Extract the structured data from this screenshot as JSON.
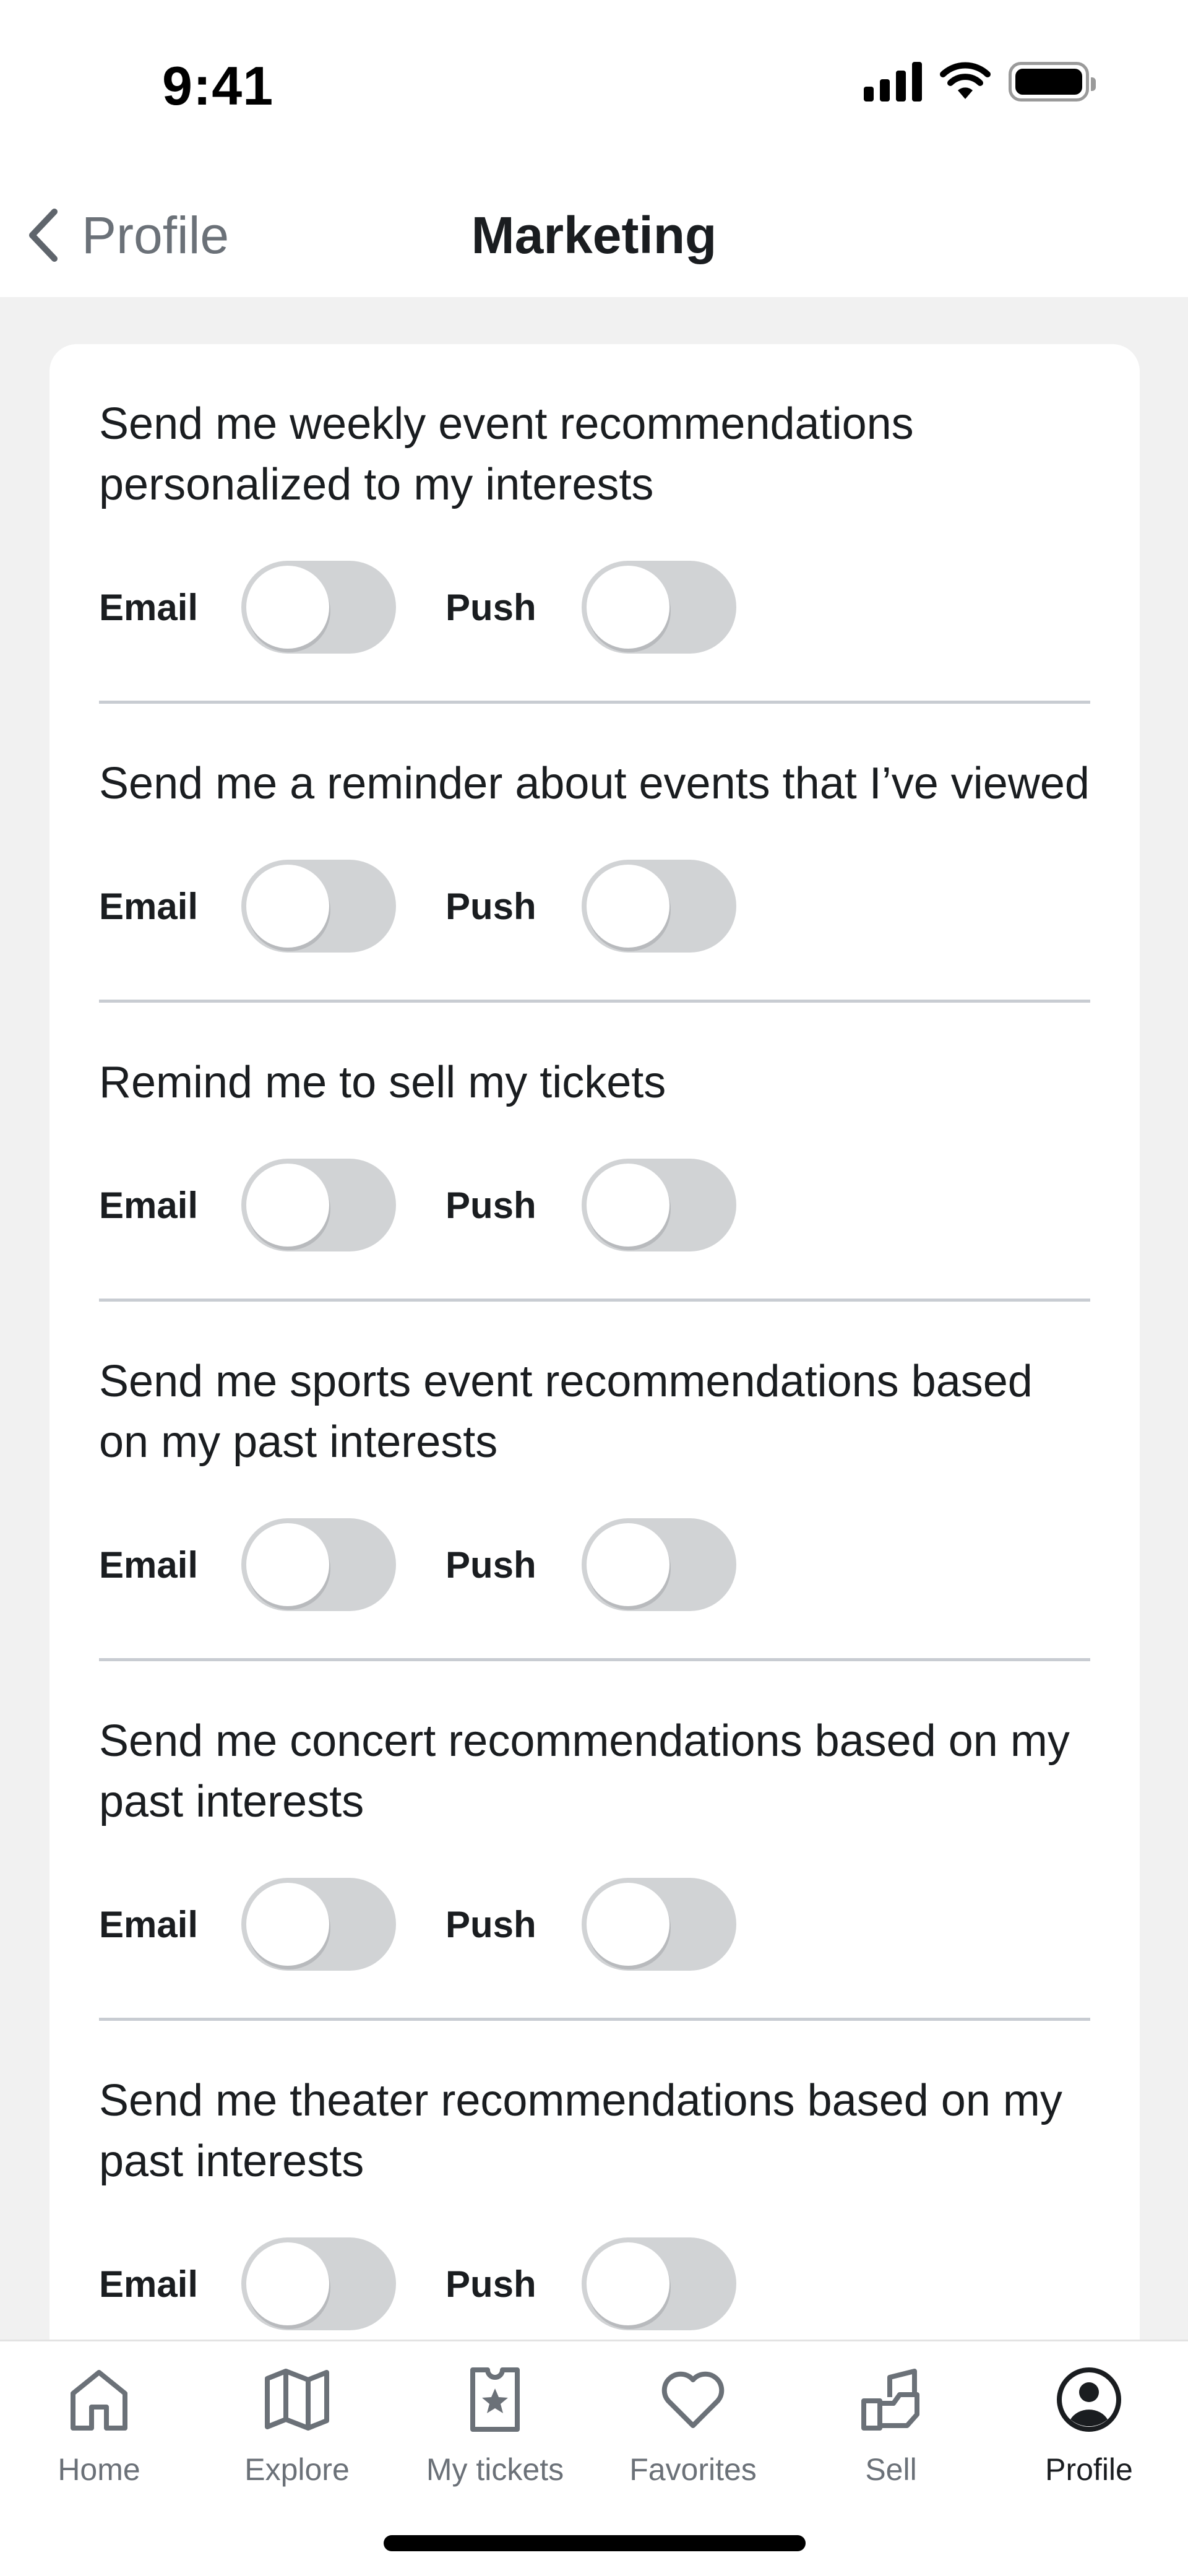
{
  "status_bar": {
    "time": "9:41"
  },
  "nav": {
    "back_label": "Profile",
    "title": "Marketing"
  },
  "preferences": [
    {
      "title": "Send me weekly event recommendations personalized to my interests",
      "email_label": "Email",
      "push_label": "Push",
      "email_on": false,
      "push_on": false
    },
    {
      "title": "Send me a reminder about events that I’ve viewed",
      "email_label": "Email",
      "push_label": "Push",
      "email_on": false,
      "push_on": false
    },
    {
      "title": "Remind me to sell my tickets",
      "email_label": "Email",
      "push_label": "Push",
      "email_on": false,
      "push_on": false
    },
    {
      "title": "Send me sports event recommendations based on my past interests",
      "email_label": "Email",
      "push_label": "Push",
      "email_on": false,
      "push_on": false
    },
    {
      "title": "Send me concert recommendations based on my past interests",
      "email_label": "Email",
      "push_label": "Push",
      "email_on": false,
      "push_on": false
    },
    {
      "title": "Send me theater recommendations based on my past interests",
      "email_label": "Email",
      "push_label": "Push",
      "email_on": false,
      "push_on": false
    }
  ],
  "tab_bar": {
    "items": [
      {
        "label": "Home",
        "icon": "home-icon"
      },
      {
        "label": "Explore",
        "icon": "map-icon"
      },
      {
        "label": "My tickets",
        "icon": "ticket-icon"
      },
      {
        "label": "Favorites",
        "icon": "heart-icon"
      },
      {
        "label": "Sell",
        "icon": "sell-icon"
      },
      {
        "label": "Profile",
        "icon": "profile-icon"
      }
    ],
    "active": "Profile"
  },
  "colors": {
    "toggle_off": "#d1d3d5",
    "divider": "#c8ccd2",
    "background": "#f1f1f1",
    "inactive_text": "#6b7178"
  }
}
